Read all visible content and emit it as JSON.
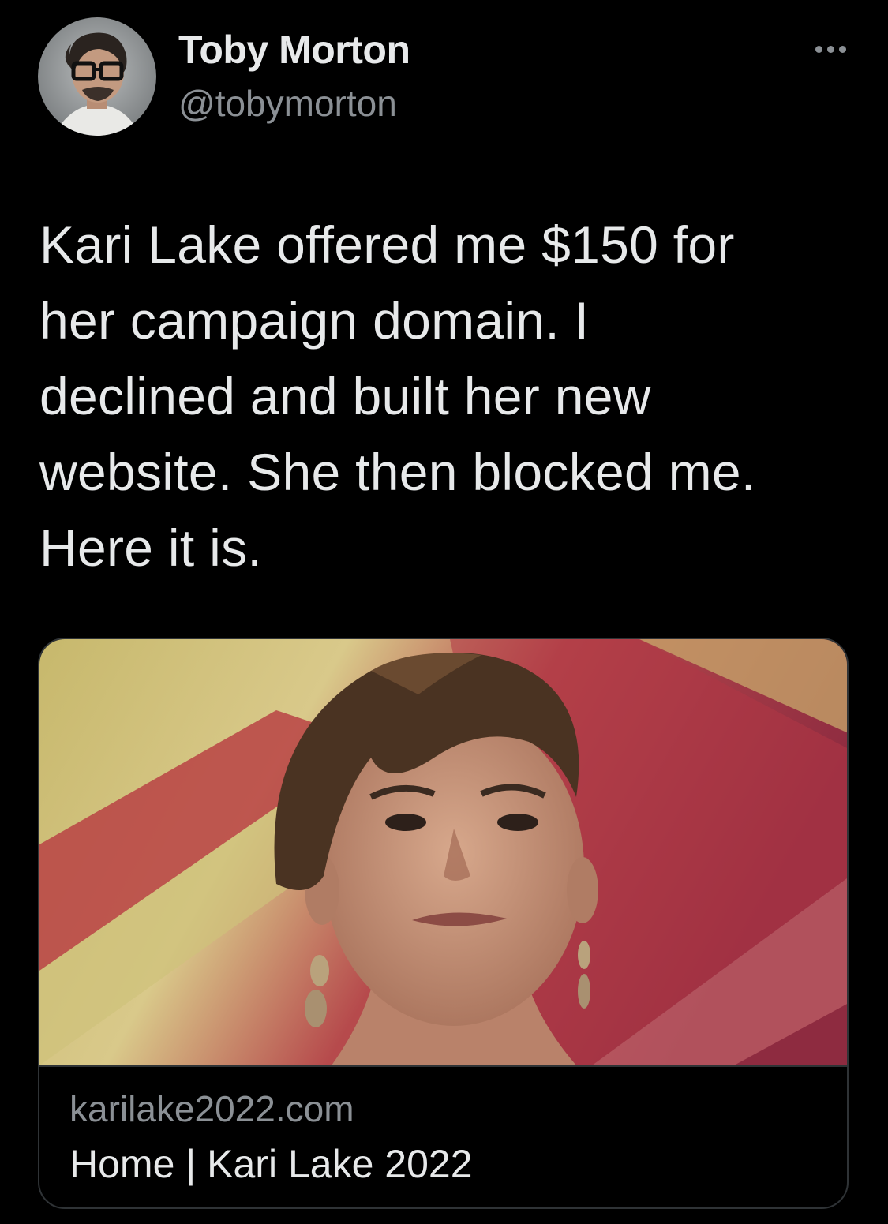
{
  "colors": {
    "background": "#000000",
    "text_primary": "#e7e9ea",
    "text_secondary": "#8b9095",
    "border": "#2f3336"
  },
  "tweet": {
    "author": {
      "display_name": "Toby Morton",
      "handle": "@tobymorton"
    },
    "more_icon": "more-horizontal-icon",
    "text": "Kari Lake offered me $150 for\nher campaign domain. I\ndeclined and built her new\nwebsite. She then blocked me.\nHere it is.",
    "link_card": {
      "domain": "karilake2022.com",
      "title": "Home | Kari Lake 2022"
    }
  }
}
